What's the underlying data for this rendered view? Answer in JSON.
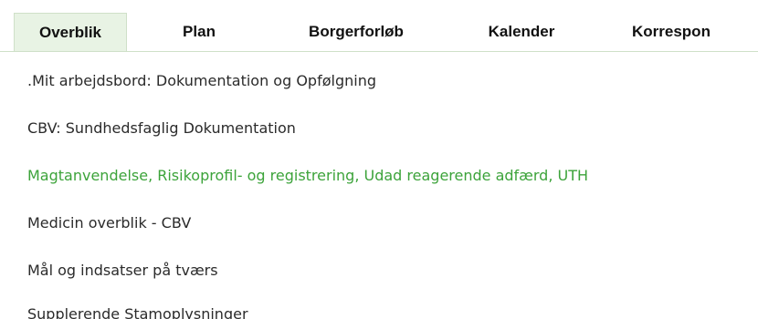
{
  "tabs": [
    {
      "label": "Overblik",
      "active": true
    },
    {
      "label": "Plan",
      "active": false
    },
    {
      "label": "Borgerforløb",
      "active": false
    },
    {
      "label": "Kalender",
      "active": false
    },
    {
      "label": "Korrespon",
      "active": false
    }
  ],
  "menu": {
    "items": [
      {
        "label": ".Mit arbejdsbord: Dokumentation og Opfølgning"
      },
      {
        "label": "CBV: Sundhedsfaglig Dokumentation"
      },
      {
        "label": "Magtanvendelse, Risikoprofil- og registrering, Udad reagerende adfærd, UTH",
        "highlighted": true
      },
      {
        "label": "Medicin overblik - CBV"
      },
      {
        "label": "Mål og indsatser på tværs"
      },
      {
        "label": "Supplerende Stamoplysninger"
      }
    ],
    "highlight_color": "#3ca33a"
  },
  "colors": {
    "active_tab_bg": "#e8f3e4",
    "text": "#2b2b2b"
  }
}
